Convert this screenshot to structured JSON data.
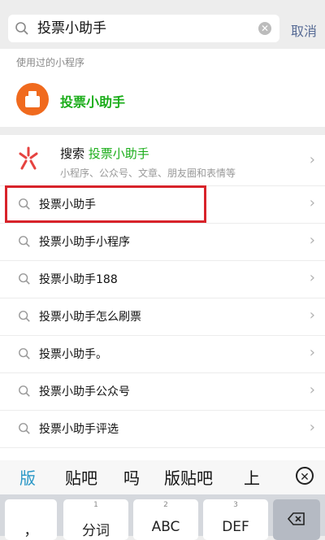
{
  "search": {
    "query": "投票小助手",
    "cancel": "取消"
  },
  "used_section": {
    "label": "使用过的小程序",
    "item_name": "投票小助手"
  },
  "search_all": {
    "prefix": "搜索",
    "keyword": "投票小助手",
    "subtitle": "小程序、公众号、文章、朋友圈和表情等"
  },
  "suggestions": [
    "投票小助手",
    "投票小助手小程序",
    "投票小助手188",
    "投票小助手怎么刷票",
    "投票小助手。",
    "投票小助手公众号",
    "投票小助手评选"
  ],
  "ime": {
    "candidates": [
      "版",
      "贴吧",
      "吗",
      "版贴吧",
      "上"
    ]
  },
  "keyboard": {
    "keys": [
      {
        "num": "",
        "label": "，"
      },
      {
        "num": "1",
        "label": "分词"
      },
      {
        "num": "2",
        "label": "ABC"
      },
      {
        "num": "3",
        "label": "DEF"
      }
    ]
  },
  "colors": {
    "accent_green": "#1aad19",
    "highlight_red": "#d8232a",
    "cancel_blue": "#576b95"
  }
}
